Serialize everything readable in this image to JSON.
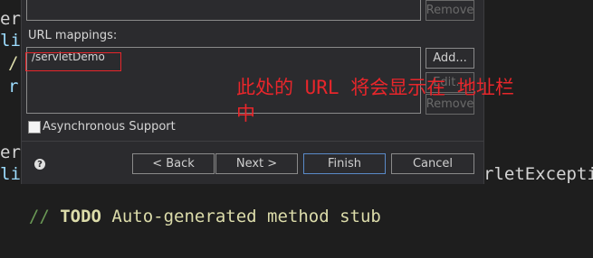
{
  "code": {
    "frag_er1": "er",
    "frag_li1": "li",
    "frag_comment1": "/",
    "frag_r1": "r",
    "frag_er2": "er",
    "frag_li2": "li",
    "frag_exception": "rletExcepti",
    "todo_line_prefix": "// ",
    "todo_keyword": "TODO",
    "todo_text": " Auto-generated method stub"
  },
  "dialog": {
    "top_remove_button": "Remove",
    "url_mappings_label": "URL mappings:",
    "url_mappings": [
      "/servletDemo"
    ],
    "add_button": "Add...",
    "edit_button": "Edit...",
    "remove_button": "Remove",
    "async_checkbox_label": "Asynchronous Support",
    "async_checked": false,
    "help_icon": "?",
    "back_button": "< Back",
    "next_button": "Next >",
    "finish_button": "Finish",
    "cancel_button": "Cancel"
  },
  "annotation": {
    "text_line1": "此处的 URL 将会显示在 地址栏",
    "text_line2": "中",
    "color": "#e8262b"
  },
  "colors": {
    "comment_green": "#6a9955",
    "todo_yellow": "#dcdcaa",
    "code_white": "#d4d4d4",
    "code_blue": "#9cdcfe"
  }
}
